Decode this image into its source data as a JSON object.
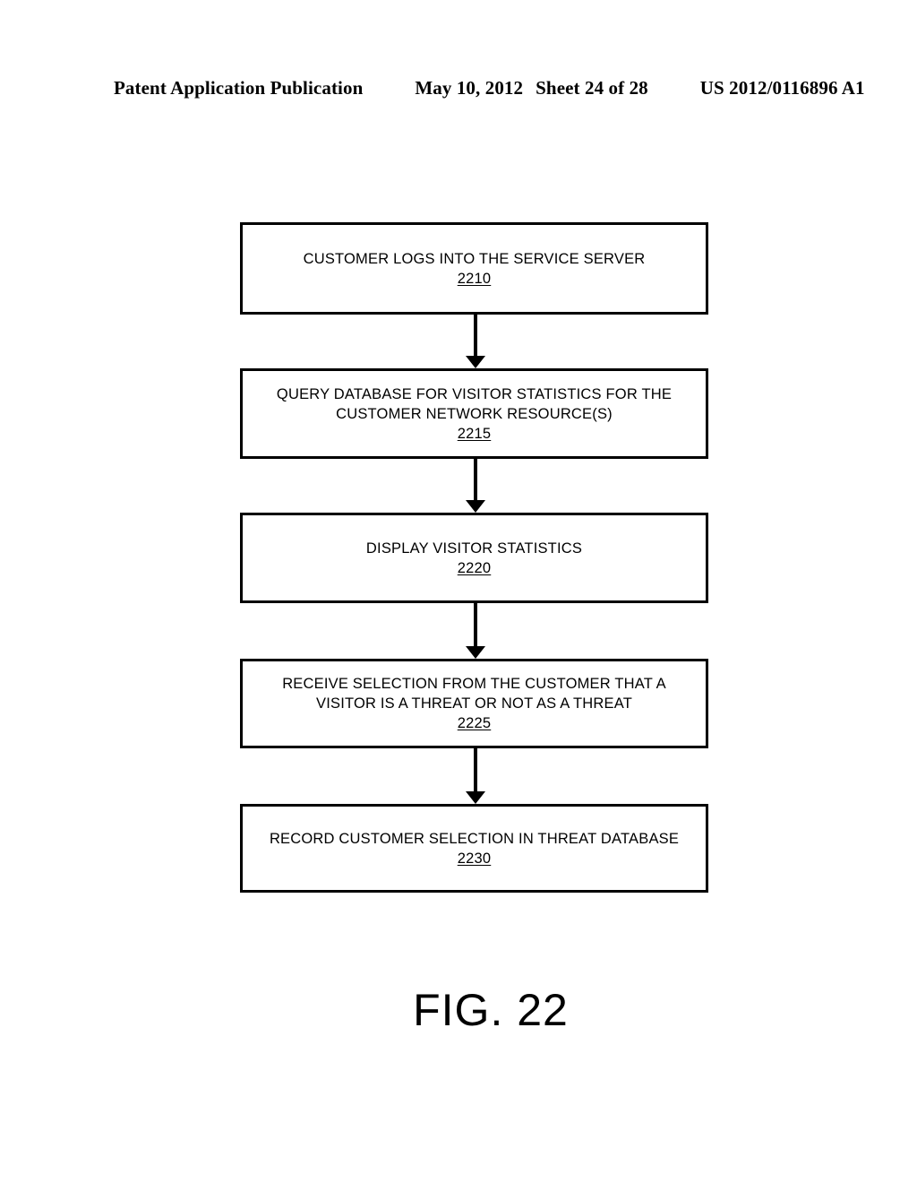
{
  "header": {
    "publication": "Patent Application Publication",
    "date": "May 10, 2012",
    "sheet": "Sheet 24 of 28",
    "number": "US 2012/0116896 A1"
  },
  "figure": {
    "caption": "FIG. 22",
    "type": "flowchart",
    "orientation": "vertical",
    "arrow_count": 4
  },
  "flow": {
    "nodes": [
      {
        "label": "CUSTOMER LOGS INTO THE SERVICE SERVER",
        "ref": "2210"
      },
      {
        "label": "QUERY DATABASE FOR VISITOR STATISTICS FOR THE CUSTOMER NETWORK RESOURCE(S)",
        "ref": "2215"
      },
      {
        "label": "DISPLAY VISITOR STATISTICS",
        "ref": "2220"
      },
      {
        "label": "RECEIVE SELECTION FROM THE CUSTOMER THAT A VISITOR IS A THREAT OR NOT AS A THREAT",
        "ref": "2225"
      },
      {
        "label": "RECORD CUSTOMER SELECTION IN THREAT DATABASE",
        "ref": "2230"
      }
    ]
  },
  "colors": {
    "ink": "#000000",
    "paper": "#ffffff"
  }
}
